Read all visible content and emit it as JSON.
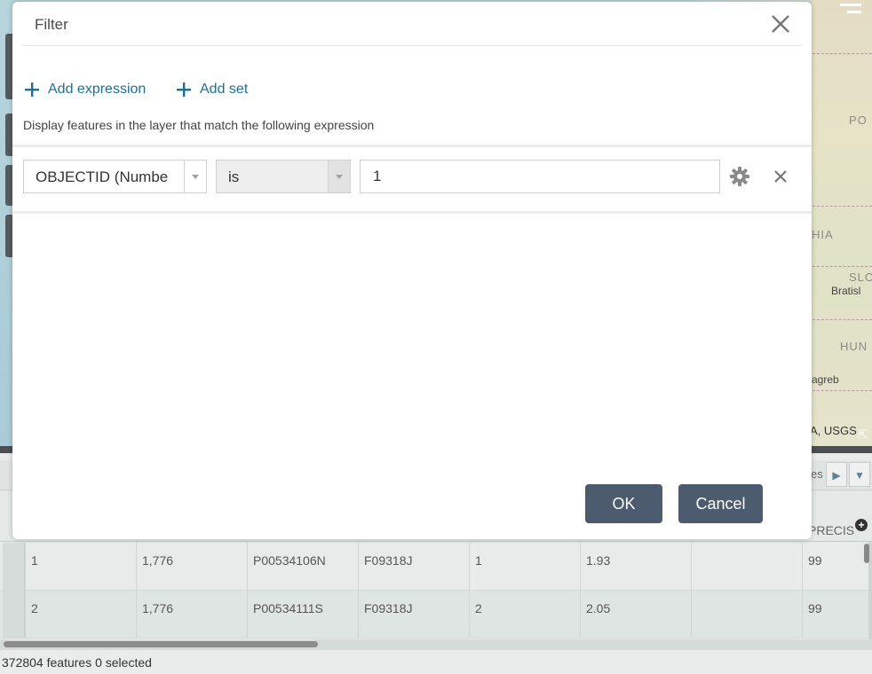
{
  "dialog": {
    "title": "Filter",
    "add_expression_label": "Add expression",
    "add_set_label": "Add set",
    "hint": "Display features in the layer that match the following expression",
    "expression": {
      "field": "OBJECTID (Numbe",
      "operator": "is",
      "value": "1"
    },
    "ok_label": "OK",
    "cancel_label": "Cancel"
  },
  "map": {
    "labels": [
      "PO",
      "HIA",
      "SLO",
      "Bratisl",
      "HUN",
      "agreb"
    ],
    "attribution": "A, USGS"
  },
  "table": {
    "tab_overflow_label": "es",
    "visible_header": "PRECIS",
    "rows": [
      [
        "1",
        "1,776",
        "P00534106N",
        "F09318J",
        "1",
        "1.93",
        "",
        "99"
      ],
      [
        "2",
        "1,776",
        "P00534111S",
        "F09318J",
        "2",
        "2.05",
        "",
        "99"
      ]
    ],
    "status": "372804 features 0 selected"
  },
  "colors": {
    "accent": "#1f6f94",
    "button_bg": "#4c5b6d",
    "splitter": "#4a4f52"
  },
  "icons": {
    "close": "close-icon",
    "plus": "plus-icon",
    "gear": "gear-icon",
    "remove": "remove-icon",
    "dropdown": "chevron-down-icon"
  }
}
